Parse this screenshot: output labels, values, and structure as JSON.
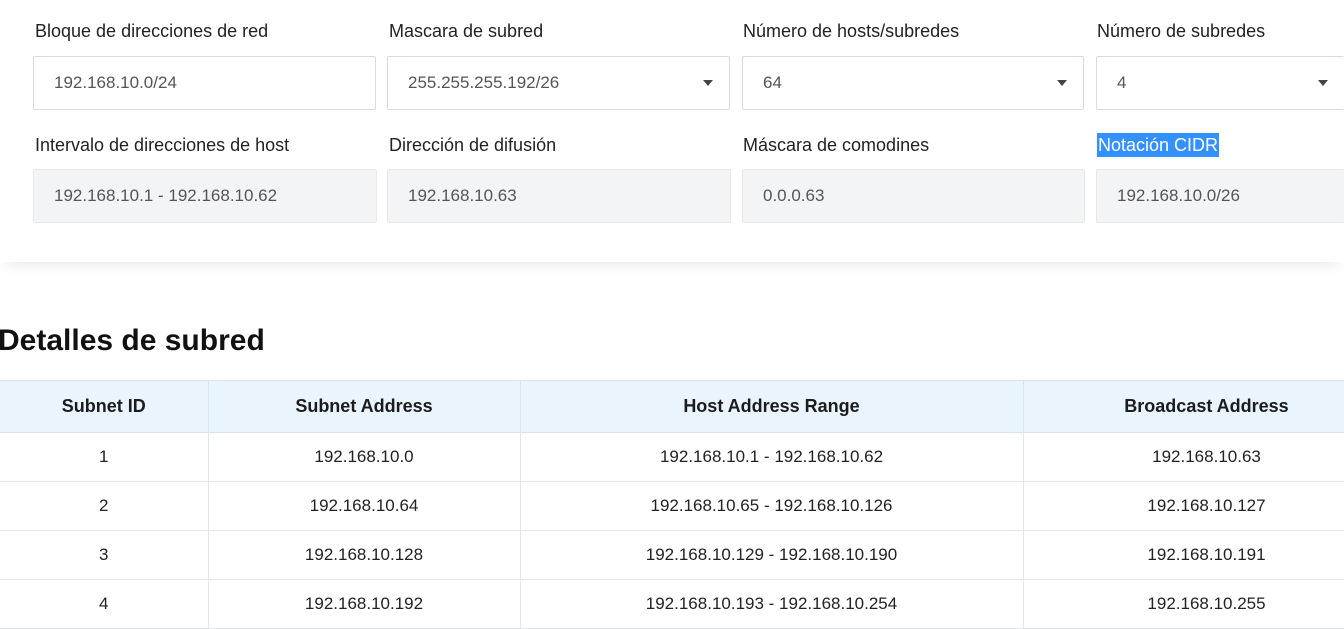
{
  "calculator": {
    "network_block": {
      "label": "Bloque de direcciones de red",
      "value": "192.168.10.0/24"
    },
    "subnet_mask": {
      "label": "Mascara de subred",
      "value": "255.255.255.192/26"
    },
    "hosts_per_subnet": {
      "label": "Número de hosts/subredes",
      "value": "64"
    },
    "subnet_count": {
      "label": "Número de subredes",
      "value": "4"
    },
    "host_range": {
      "label": "Intervalo de direcciones de host",
      "value": "192.168.10.1 - 192.168.10.62"
    },
    "broadcast": {
      "label": "Dirección de difusión",
      "value": "192.168.10.63"
    },
    "wildcard": {
      "label": "Máscara de comodines",
      "value": "0.0.0.63"
    },
    "cidr": {
      "label": "Notación CIDR",
      "value": "192.168.10.0/26"
    }
  },
  "details": {
    "title": "Detalles de subred",
    "columns": [
      "Subnet ID",
      "Subnet Address",
      "Host Address Range",
      "Broadcast Address"
    ],
    "rows": [
      [
        "1",
        "192.168.10.0",
        "192.168.10.1 - 192.168.10.62",
        "192.168.10.63"
      ],
      [
        "2",
        "192.168.10.64",
        "192.168.10.65 - 192.168.10.126",
        "192.168.10.127"
      ],
      [
        "3",
        "192.168.10.128",
        "192.168.10.129 - 192.168.10.190",
        "192.168.10.191"
      ],
      [
        "4",
        "192.168.10.192",
        "192.168.10.193 - 192.168.10.254",
        "192.168.10.255"
      ]
    ]
  },
  "colors": {
    "selection": "#3391ff",
    "header_bg": "#eaf4fd",
    "readonly_bg": "#f3f4f6"
  }
}
